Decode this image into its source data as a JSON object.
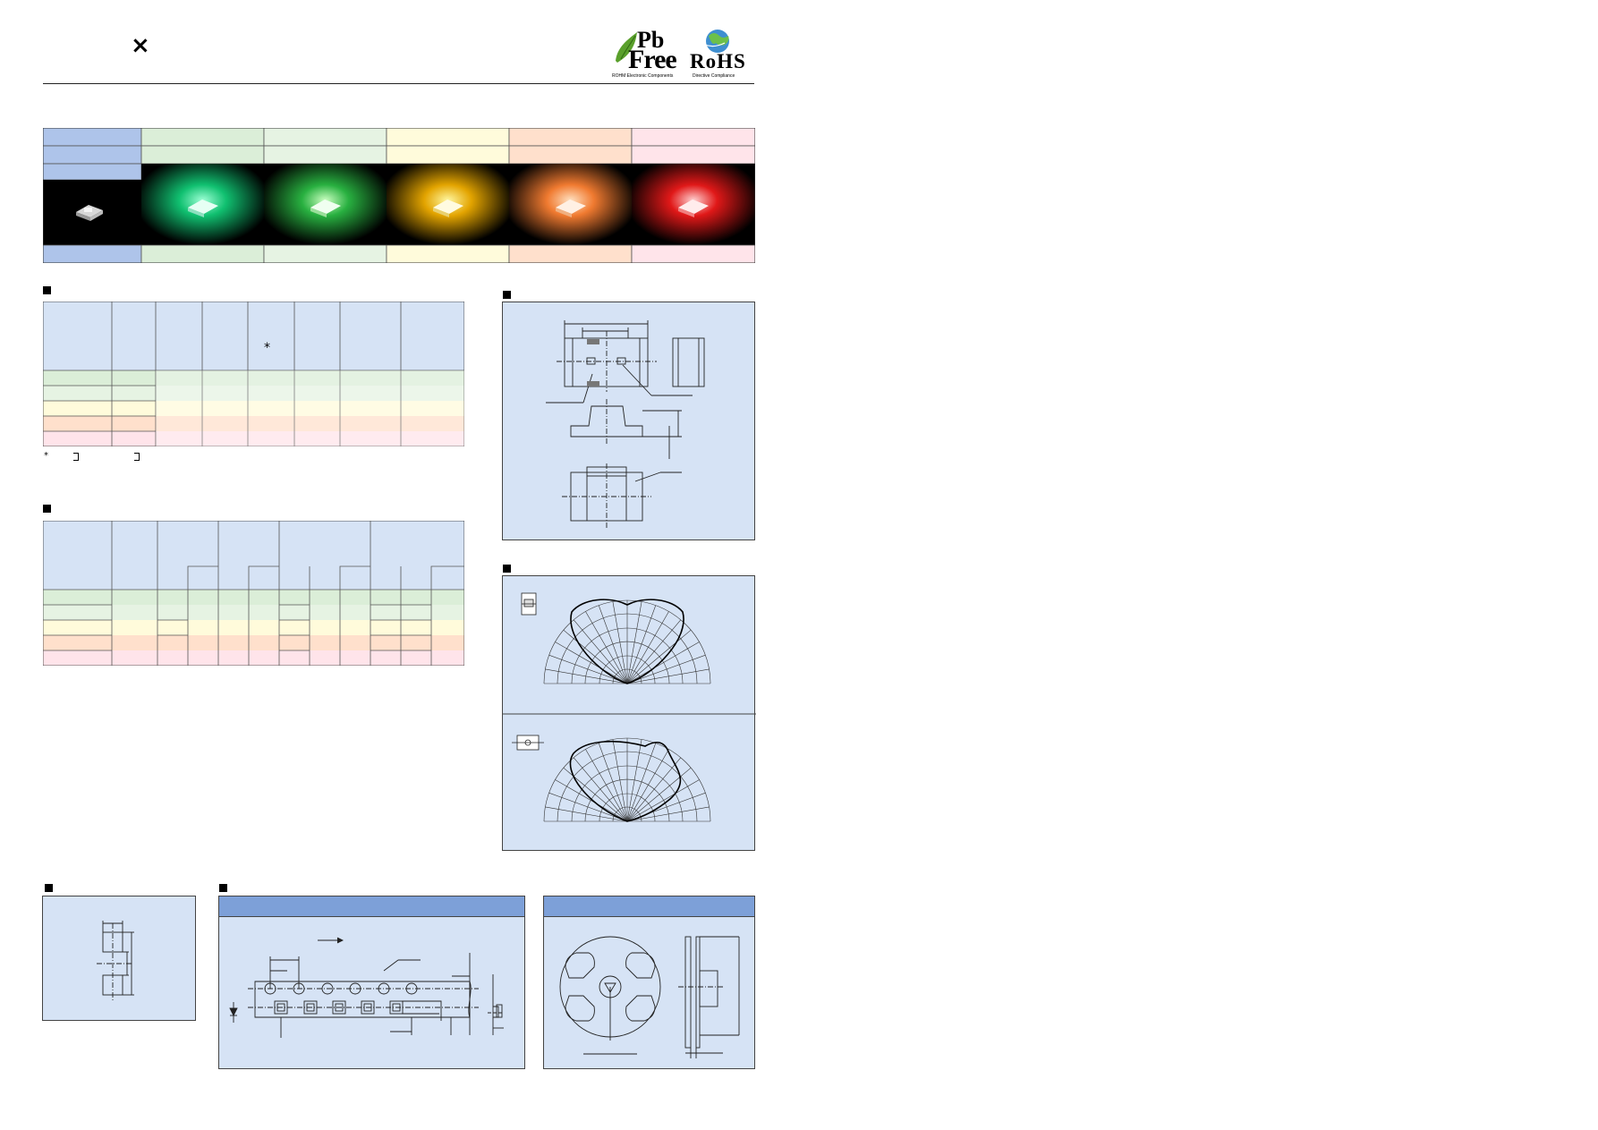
{
  "header": {
    "close_glyph": "×",
    "logo_pb": "Pb",
    "logo_free": "Free",
    "logo_pb_caption": "ROHM Electronic Components",
    "logo_rohs": "RoHS",
    "logo_rohs_caption": "Directive Compliance"
  },
  "colors": {
    "accent_blue": "#7da0d8",
    "panel_blue": "#d6e3f5",
    "header_blue": "#aec4ea",
    "green1": "#dbeed8",
    "green2": "#e6f3e3",
    "yellow": "#fffbdb",
    "orange": "#ffe0cc",
    "red": "#ffe4ea"
  },
  "spec_table": {
    "star_mark": "*",
    "footnote_star": "*"
  },
  "sections": {
    "bullet_icon": "square-bullet"
  }
}
